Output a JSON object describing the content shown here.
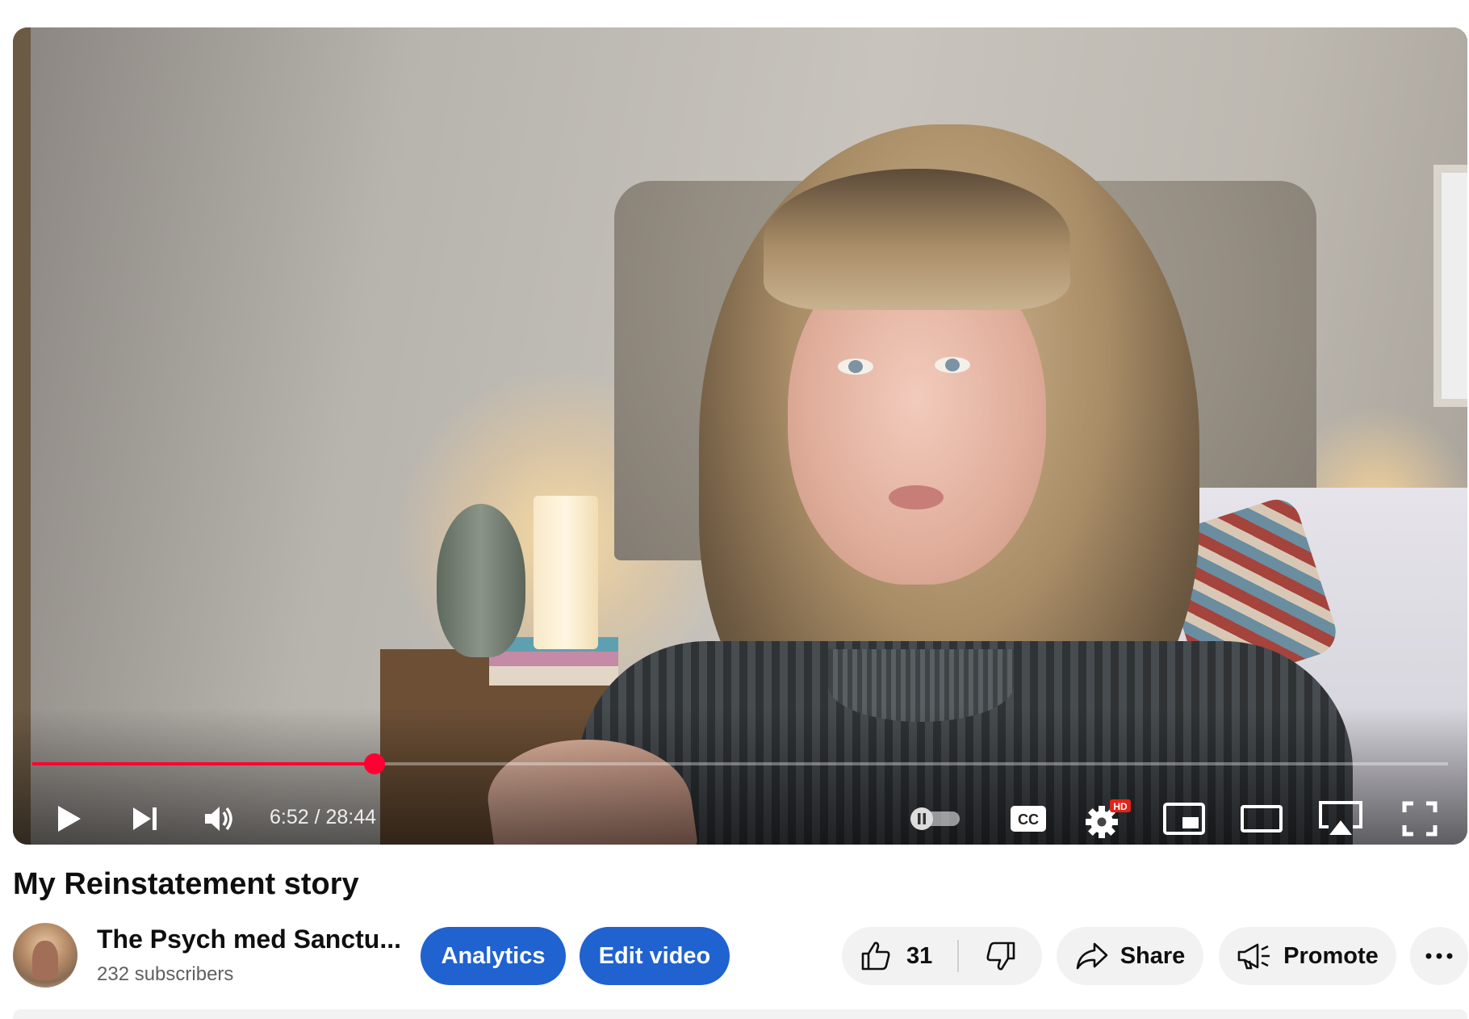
{
  "video": {
    "title": "My Reinstatement story",
    "current_time": "6:52",
    "duration": "28:44",
    "time_display": "6:52 / 28:44",
    "progress_fraction": 0.242,
    "buffered_fraction": 0.248,
    "quality_badge": "HD",
    "accent_color": "#ff0033"
  },
  "controls": {
    "play_icon": "play-icon",
    "next_icon": "next-icon",
    "volume_icon": "volume-icon",
    "autoplay_icon": "autoplay-toggle-icon",
    "captions_label": "CC",
    "settings_icon": "gear-icon",
    "miniplayer_icon": "miniplayer-icon",
    "theater_icon": "theater-mode-icon",
    "airplay_icon": "airplay-icon",
    "fullscreen_icon": "fullscreen-icon"
  },
  "channel": {
    "name": "The Psych med Sanctu...",
    "subscribers": "232 subscribers"
  },
  "actions": {
    "analytics_label": "Analytics",
    "edit_label": "Edit video",
    "like_count": "31",
    "share_label": "Share",
    "promote_label": "Promote",
    "primary_button_color": "#1f62d0"
  }
}
